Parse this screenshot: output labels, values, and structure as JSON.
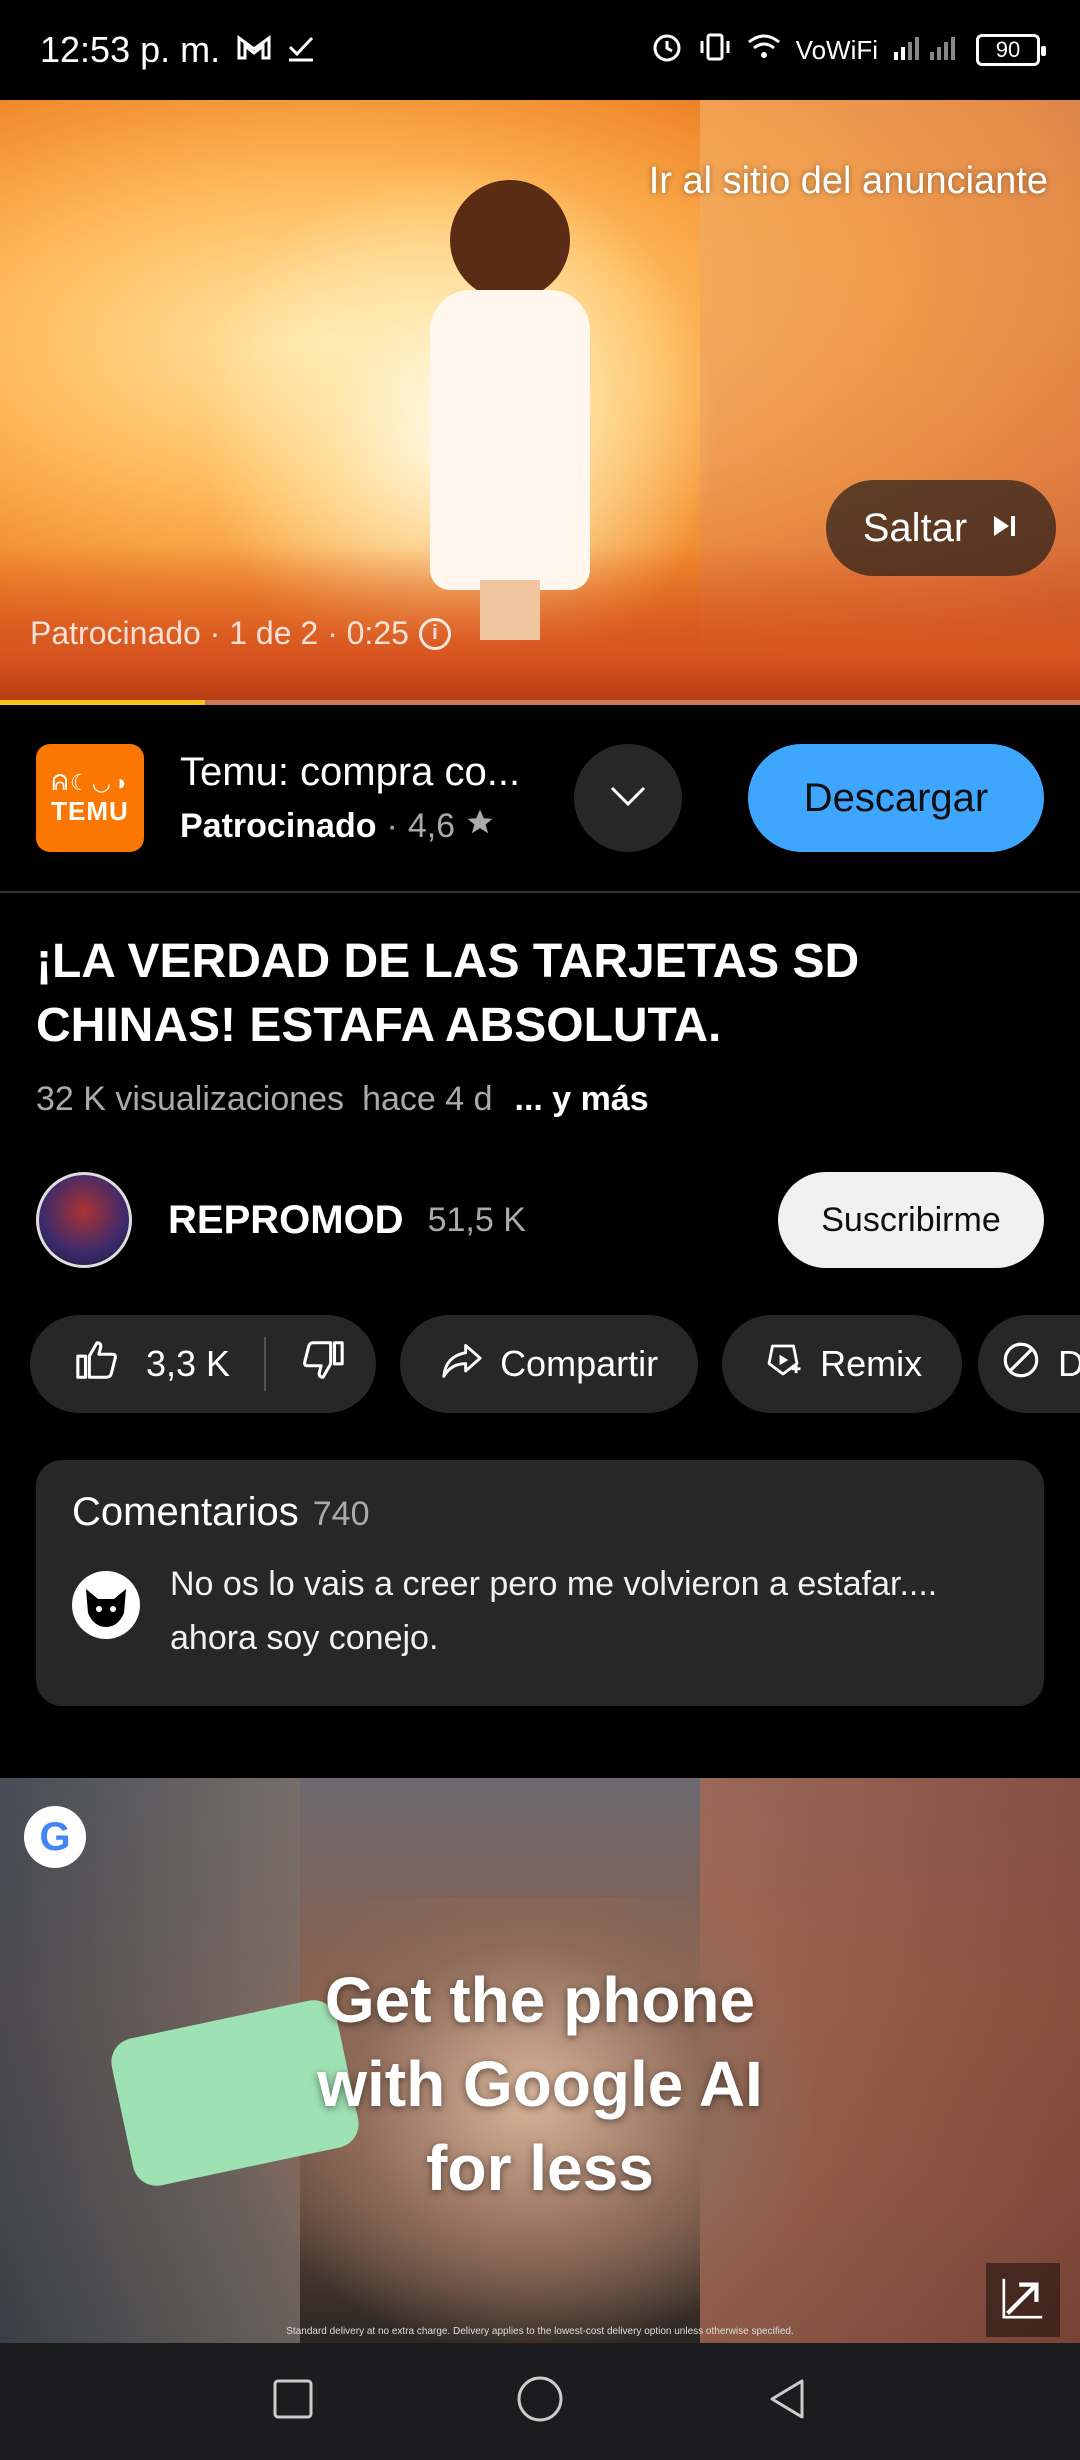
{
  "status_bar": {
    "time": "12:53 p. m.",
    "network": "VoWiFi",
    "battery": "90"
  },
  "player": {
    "advertiser_link": "Ir al sitio del anunciante",
    "skip_label": "Saltar",
    "ad_info": "Patrocinado · 1 de 2 · 0:25",
    "progress_fraction": 0.19
  },
  "ad_card": {
    "logo_glyphs": "ᕱ☾◡◑",
    "logo_word": "TEMU",
    "title": "Temu: compra co...",
    "sponsored": "Patrocinado",
    "separator": "·",
    "rating": "4,6",
    "download_label": "Descargar"
  },
  "video": {
    "title": "¡LA VERDAD DE LAS TARJETAS SD CHINAS! ESTAFA ABSOLUTA.",
    "views": "32 K visualizaciones",
    "age": "hace 4 d",
    "more": "... y más"
  },
  "channel": {
    "name": "REPROMOD",
    "subscribers": "51,5 K",
    "subscribe_label": "Suscribirme"
  },
  "actions": {
    "likes": "3,3 K",
    "share": "Compartir",
    "remix": "Remix",
    "next_partial": "D"
  },
  "comments": {
    "header": "Comentarios",
    "count": "740",
    "top_comment": "No os lo vais a creer pero me volvieron a estafar.... ahora soy conejo."
  },
  "google_ad": {
    "badge": "G",
    "headline_lines": [
      "Get the phone",
      "with Google AI",
      "for less"
    ],
    "disclaimer": "Standard delivery at no extra charge. Delivery applies to the lowest-cost delivery option unless otherwise specified."
  },
  "colors": {
    "download_button": "#3ea6ff",
    "temu_orange": "#fb7701",
    "chip_bg": "#272727",
    "progress": "#f5c518"
  }
}
